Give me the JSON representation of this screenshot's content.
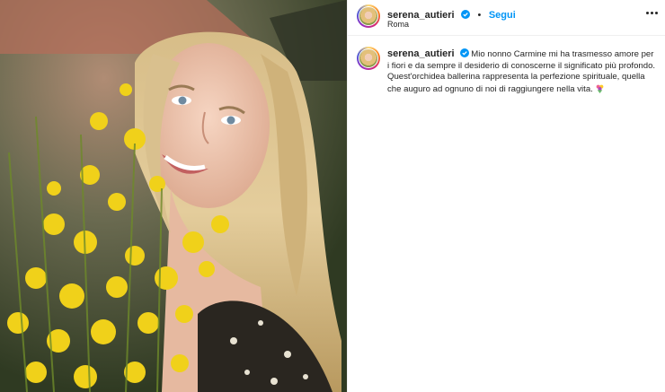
{
  "post": {
    "photo_alt": "serena_autieri",
    "header": {
      "username": "serena_autieri",
      "separator": "•",
      "follow_label": "Segui",
      "location": "Roma",
      "more_icon": "more-options-icon"
    },
    "caption": {
      "username": "serena_autieri",
      "line1": "Mio nonno Carmine mi ha trasmesso amore per i fiori e da sempre il desiderio di conoscerne il significato più profondo.",
      "line2": "Quest'orchidea ballerina rappresenta la perfezione spirituale, quella che auguro ad ognuno di noi di raggiungere nella vita.",
      "emoji_icon": "flower-bouquet-icon"
    },
    "colors": {
      "follow_blue": "#0095f6",
      "verified_blue": "#0095f6",
      "text": "#262626"
    }
  }
}
